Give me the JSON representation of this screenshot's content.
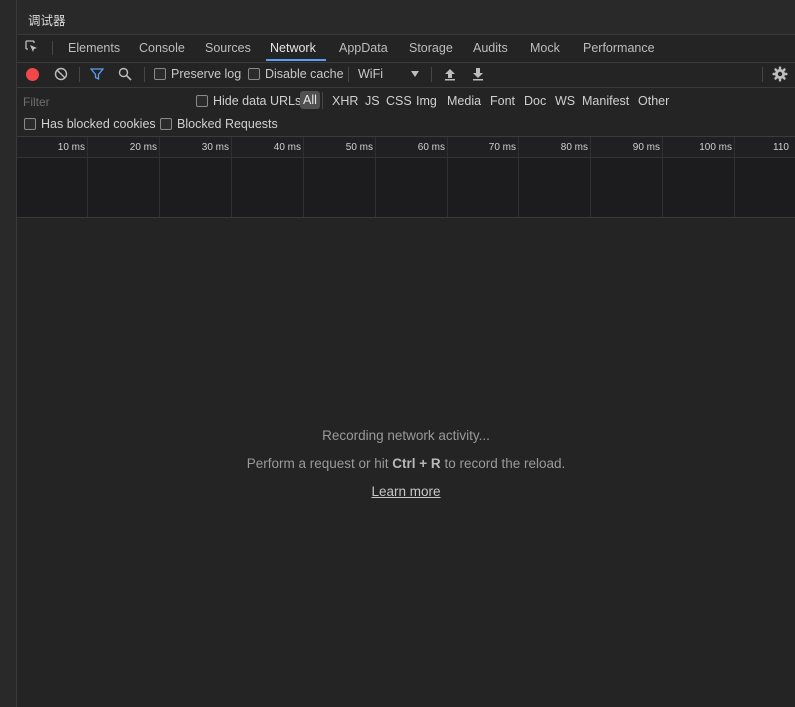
{
  "window": {
    "title": "调试器"
  },
  "tabs": [
    {
      "label": "Elements"
    },
    {
      "label": "Console"
    },
    {
      "label": "Sources"
    },
    {
      "label": "Network",
      "active": true
    },
    {
      "label": "AppData"
    },
    {
      "label": "Storage"
    },
    {
      "label": "Audits"
    },
    {
      "label": "Mock"
    },
    {
      "label": "Performance"
    }
  ],
  "toolbar": {
    "preserve_log": "Preserve log",
    "disable_cache": "Disable cache",
    "throttle": "WiFi",
    "record_color": "#f0484a"
  },
  "filter": {
    "placeholder": "Filter",
    "hide_data_urls": "Hide data URLs",
    "types": [
      "All",
      "XHR",
      "JS",
      "CSS",
      "Img",
      "Media",
      "Font",
      "Doc",
      "WS",
      "Manifest",
      "Other"
    ],
    "has_blocked_cookies": "Has blocked cookies",
    "blocked_requests": "Blocked Requests"
  },
  "timeline": {
    "ticks": [
      "10 ms",
      "20 ms",
      "30 ms",
      "40 ms",
      "50 ms",
      "60 ms",
      "70 ms",
      "80 ms",
      "90 ms",
      "100 ms",
      "110"
    ]
  },
  "empty_state": {
    "line1": "Recording network activity...",
    "line2_prefix": "Perform a request or hit ",
    "line2_key": "Ctrl + R",
    "line2_suffix": " to record the reload.",
    "learn_more": "Learn more"
  },
  "accent": "#5c9ef0"
}
